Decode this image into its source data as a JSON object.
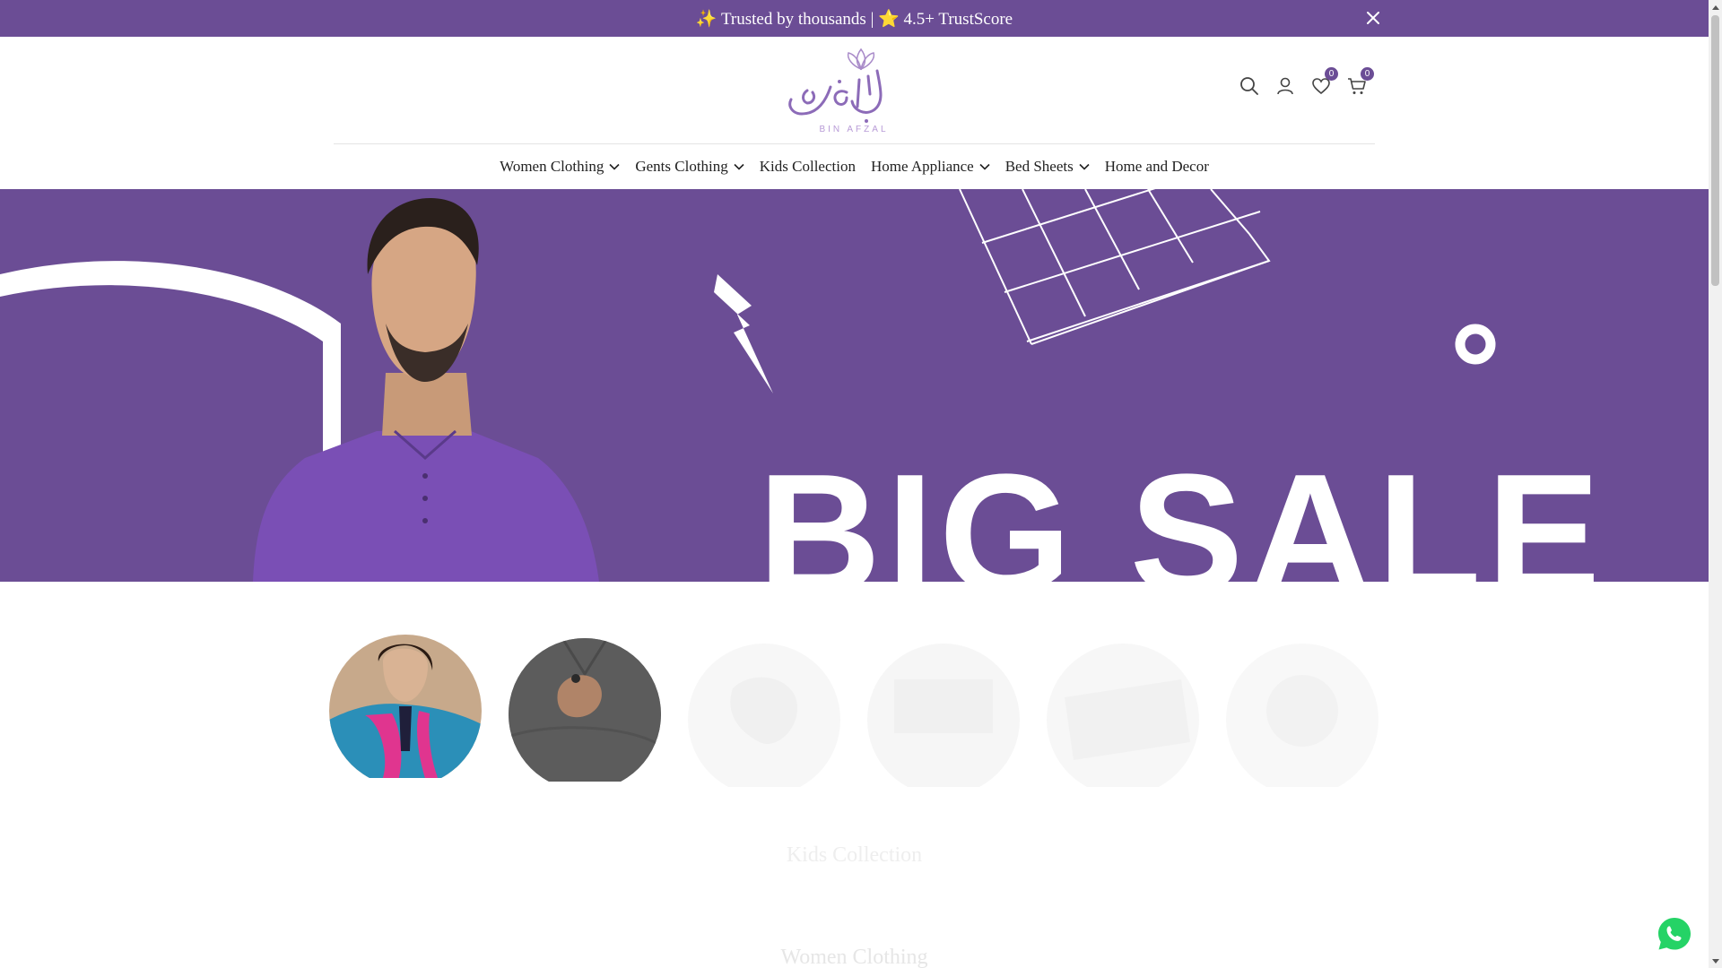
{
  "announcement": {
    "text": "✨ Trusted by thousands | ⭐ 4.5+ TrustScore"
  },
  "header": {
    "logo_text": "BIN AFZAL",
    "wishlist_count": "0",
    "cart_count": "0"
  },
  "nav": {
    "items": [
      {
        "label": "Women Clothing",
        "has_dropdown": true
      },
      {
        "label": "Gents Clothing",
        "has_dropdown": true
      },
      {
        "label": "Kids Collection",
        "has_dropdown": false
      },
      {
        "label": "Home Appliance",
        "has_dropdown": true
      },
      {
        "label": "Bed Sheets",
        "has_dropdown": true
      },
      {
        "label": "Home and Decor",
        "has_dropdown": false
      }
    ]
  },
  "hero": {
    "headline": "BIG SALE"
  },
  "sections": {
    "kids_title": "Kids Collection",
    "women_title": "Women Clothing"
  },
  "colors": {
    "brand": "#6b4d95",
    "whatsapp": "#25d366"
  }
}
